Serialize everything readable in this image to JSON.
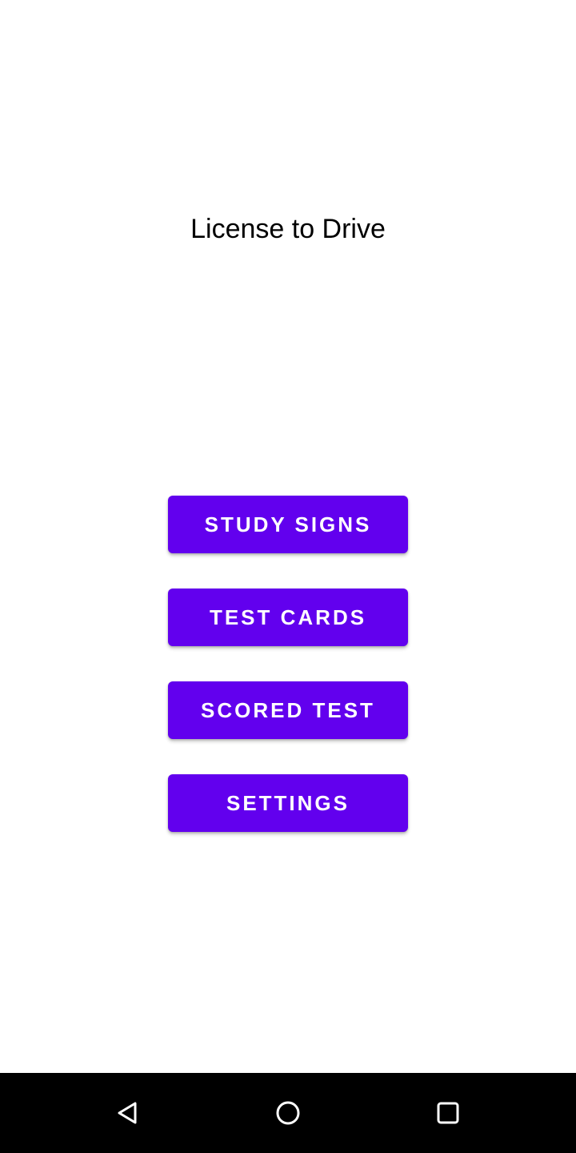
{
  "app": {
    "title": "License to Drive"
  },
  "menu": {
    "items": [
      {
        "label": "STUDY SIGNS"
      },
      {
        "label": "TEST CARDS"
      },
      {
        "label": "SCORED TEST"
      },
      {
        "label": "SETTINGS"
      }
    ]
  },
  "colors": {
    "button_background": "#6200ee",
    "button_text": "#ffffff",
    "background": "#ffffff",
    "nav_bar": "#000000"
  },
  "nav_bar": {
    "icons": [
      "back-icon",
      "home-icon",
      "recents-icon"
    ]
  }
}
